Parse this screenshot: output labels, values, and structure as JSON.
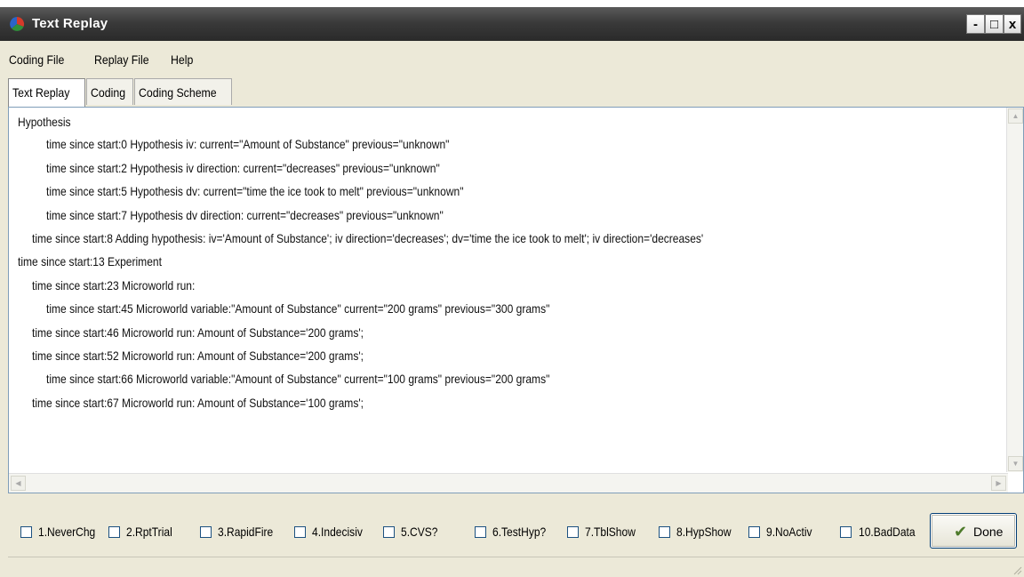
{
  "window": {
    "title": "Text Replay"
  },
  "window_controls": {
    "minimize": "-",
    "maximize": "□",
    "close": "x"
  },
  "menubar": {
    "items": [
      {
        "label": "Coding File"
      },
      {
        "label": "Replay File"
      },
      {
        "label": "Help"
      }
    ]
  },
  "tabs": [
    {
      "label": "Text Replay",
      "active": true
    },
    {
      "label": "Coding",
      "active": false
    },
    {
      "label": "Coding Scheme",
      "active": false
    }
  ],
  "log": [
    "Hypothesis",
    "time since start:0 Hypothesis iv: current=\"Amount of Substance\" previous=\"unknown\"",
    "time since start:2 Hypothesis iv direction: current=\"decreases\" previous=\"unknown\"",
    "time since start:5 Hypothesis dv: current=\"time the ice took to melt\" previous=\"unknown\"",
    "time since start:7 Hypothesis dv direction: current=\"decreases\" previous=\"unknown\"",
    "time since start:8 Adding hypothesis: iv='Amount of Substance'; iv direction='decreases';  dv='time the ice took to melt'; iv direction='decreases'",
    "time since start:13 Experiment",
    "time since start:23 Microworld run:",
    "time since start:45 Microworld variable:\"Amount of Substance\" current=\"200 grams\" previous=\"300 grams\"",
    "time since start:46 Microworld run: Amount of Substance='200 grams';",
    "time since start:52 Microworld run: Amount of Substance='200 grams';",
    "time since start:66 Microworld variable:\"Amount of Substance\" current=\"100 grams\" previous=\"200 grams\"",
    "time since start:67 Microworld run: Amount of Substance='100 grams';"
  ],
  "checkboxes": [
    {
      "label": "1.NeverChg",
      "checked": false
    },
    {
      "label": "2.RptTrial",
      "checked": false
    },
    {
      "label": "3.RapidFire",
      "checked": false
    },
    {
      "label": "4.Indecisiv",
      "checked": false
    },
    {
      "label": "5.CVS?",
      "checked": false
    },
    {
      "label": "6.TestHyp?",
      "checked": false
    },
    {
      "label": "7.TblShow",
      "checked": false
    },
    {
      "label": "8.HypShow",
      "checked": false
    },
    {
      "label": "9.NoActiv",
      "checked": false
    },
    {
      "label": "10.BadData",
      "checked": false
    }
  ],
  "done_button": {
    "label": "Done",
    "icon": "checkmark-icon"
  },
  "colors": {
    "titlebar": "#3a3a3a",
    "chrome": "#ece9d8",
    "border": "#7f9db9"
  }
}
